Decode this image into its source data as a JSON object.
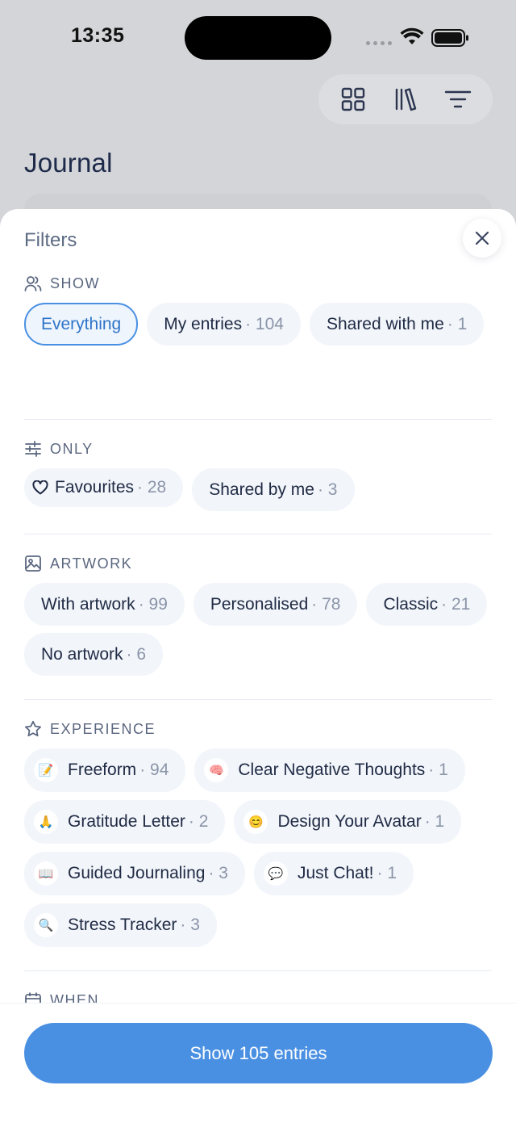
{
  "status": {
    "time": "13:35"
  },
  "page": {
    "title": "Journal"
  },
  "sheet": {
    "title": "Filters",
    "sections": {
      "show": {
        "label": "SHOW",
        "chips": [
          {
            "label": "Everything",
            "count": "",
            "selected": true
          },
          {
            "label": "My entries",
            "count": "· 104"
          },
          {
            "label": "Shared with me",
            "count": "· 1"
          }
        ]
      },
      "only": {
        "label": "ONLY",
        "chips": [
          {
            "label": "Favourites",
            "count": "· 28"
          },
          {
            "label": "Shared by me",
            "count": "· 3"
          }
        ]
      },
      "artwork": {
        "label": "ARTWORK",
        "chips": [
          {
            "label": "With artwork",
            "count": "· 99"
          },
          {
            "label": "Personalised",
            "count": "· 78"
          },
          {
            "label": "Classic",
            "count": "· 21"
          },
          {
            "label": "No artwork",
            "count": "· 6"
          }
        ]
      },
      "experience": {
        "label": "EXPERIENCE",
        "chips": [
          {
            "label": "Freeform",
            "count": "· 94",
            "icon": "📝"
          },
          {
            "label": "Clear Negative Thoughts",
            "count": "· 1",
            "icon": "🧠"
          },
          {
            "label": "Gratitude Letter",
            "count": "· 2",
            "icon": "🙏"
          },
          {
            "label": "Design Your Avatar",
            "count": "· 1",
            "icon": "😊"
          },
          {
            "label": "Guided Journaling",
            "count": "· 3",
            "icon": "📖"
          },
          {
            "label": "Just Chat!",
            "count": "· 1",
            "icon": "💬"
          },
          {
            "label": "Stress Tracker",
            "count": "· 3",
            "icon": "🔍"
          }
        ]
      },
      "when": {
        "label": "WHEN"
      }
    },
    "cta": "Show 105 entries"
  },
  "colors": {
    "accent": "#4a90e2",
    "chip_bg": "#f2f5fa",
    "text": "#1f2a44",
    "muted": "#8b95a8"
  }
}
